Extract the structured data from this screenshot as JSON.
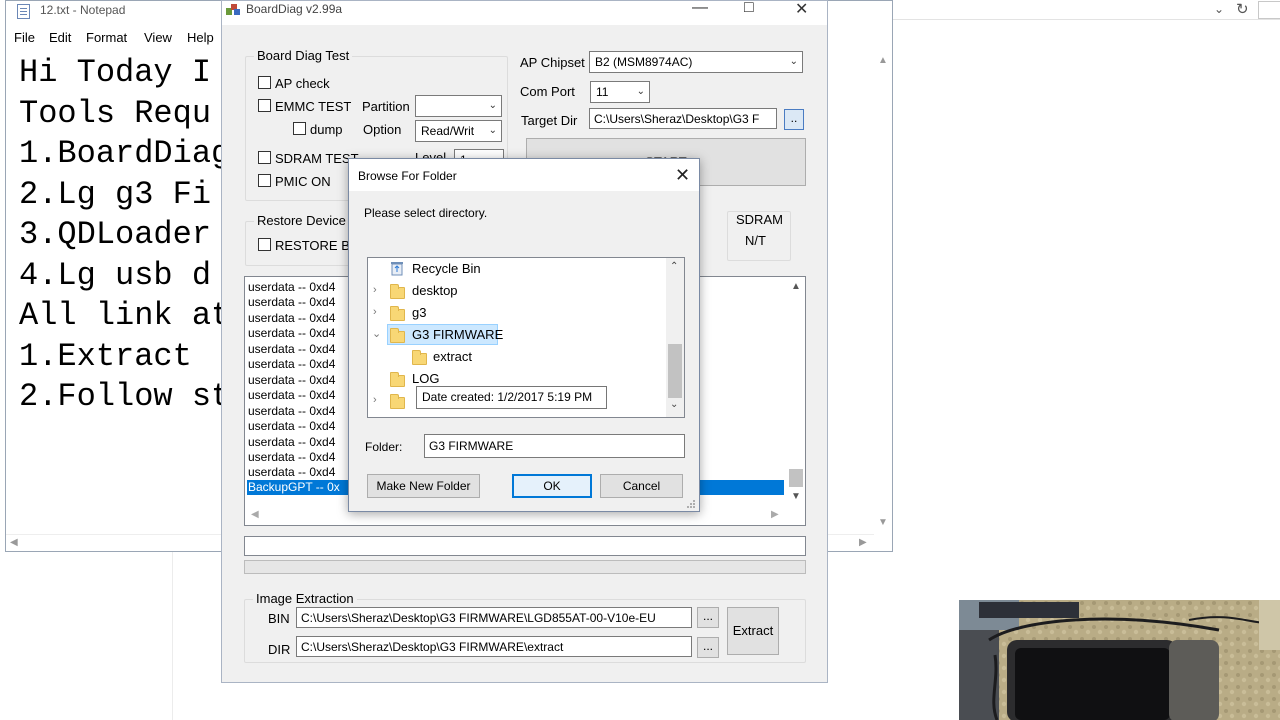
{
  "browser": {
    "dropdown_icon": "chevron-down-icon",
    "refresh_icon": "refresh-icon",
    "close_glyph": "✕"
  },
  "notepad": {
    "title": "12.txt - Notepad",
    "menu": [
      "File",
      "Edit",
      "Format",
      "View",
      "Help"
    ],
    "lines": [
      "Hi Today I",
      "Tools Requ",
      "1.BoardDiag",
      "2.Lg g3 Fi",
      "3.QDLoader",
      "4.Lg usb d",
      "All link at",
      "1.Extract",
      "2.Follow st"
    ]
  },
  "boarddiag": {
    "title": "BoardDiag v2.99a",
    "board_diag_test": {
      "label": "Board Diag Test",
      "ap_check": "AP check",
      "emmc_test": "EMMC TEST",
      "partition_label": "Partition",
      "partition_value": "",
      "dump": "dump",
      "option_label": "Option",
      "option_value": "Read/Writ",
      "sdram_test": "SDRAM TEST",
      "level_label": "Level",
      "level_value": "1",
      "pmic_on": "PMIC ON"
    },
    "ap_chipset_label": "AP Chipset",
    "ap_chipset_value": "B2 (MSM8974AC)",
    "com_port_label": "Com Port",
    "com_port_value": "11",
    "target_dir_label": "Target Dir",
    "target_dir_value": "C:\\Users\\Sheraz\\Desktop\\G3 F",
    "browse_button": "..",
    "start_button": "START",
    "restore_device": {
      "label": "Restore Device",
      "restore_boot": "RESTORE BOOT"
    },
    "sdram_status": {
      "label": "SDRAM",
      "value": "N/T"
    },
    "log_items": [
      "userdata -- 0xd4",
      "userdata -- 0xd4",
      "userdata -- 0xd4",
      "userdata -- 0xd4",
      "userdata -- 0xd4",
      "userdata -- 0xd4",
      "userdata -- 0xd4",
      "userdata -- 0xd4",
      "userdata -- 0xd4",
      "userdata -- 0xd4",
      "userdata -- 0xd4",
      "userdata -- 0xd4",
      "userdata -- 0xd4"
    ],
    "selected_item": "BackupGPT -- 0x",
    "image_extraction": {
      "label": "Image Extraction",
      "bin_label": "BIN",
      "bin_value": "C:\\Users\\Sheraz\\Desktop\\G3 FIRMWARE\\LGD855AT-00-V10e-EU",
      "dir_label": "DIR",
      "dir_value": "C:\\Users\\Sheraz\\Desktop\\G3 FIRMWARE\\extract",
      "bin_browse": "...",
      "dir_browse": "...",
      "extract_button": "Extract"
    }
  },
  "dialog": {
    "title": "Browse For Folder",
    "subtitle": "Please select directory.",
    "tree": [
      {
        "name": "Recycle Bin",
        "icon": "recycle-bin-icon"
      },
      {
        "name": "desktop",
        "icon": "folder-icon"
      },
      {
        "name": "g3",
        "icon": "folder-icon"
      },
      {
        "name": "G3 FIRMWARE",
        "icon": "folder-icon",
        "expanded": true,
        "selected": true
      },
      {
        "name": "extract",
        "icon": "folder-icon"
      },
      {
        "name": "LOG",
        "icon": "folder-icon"
      }
    ],
    "tooltip": "Date created: 1/2/2017 5:19 PM",
    "folder_label": "Folder:",
    "folder_value": "G3 FIRMWARE",
    "make_new_folder": "Make New Folder",
    "ok": "OK",
    "cancel": "Cancel"
  }
}
